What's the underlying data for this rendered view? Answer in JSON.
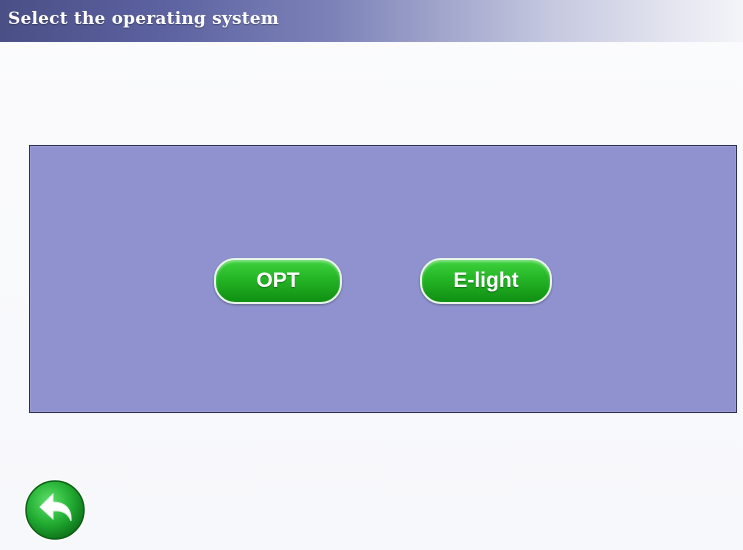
{
  "header": {
    "title": "Select the operating system"
  },
  "panel": {
    "buttons": [
      {
        "label": "OPT"
      },
      {
        "label": "E-light"
      }
    ]
  },
  "back_button": {
    "icon": "back-arrow-icon"
  },
  "colors": {
    "title_bar": "#4a4f86",
    "panel": "#8f92cf",
    "button_green": "#27b827",
    "back_green": "#1e9e2a"
  }
}
